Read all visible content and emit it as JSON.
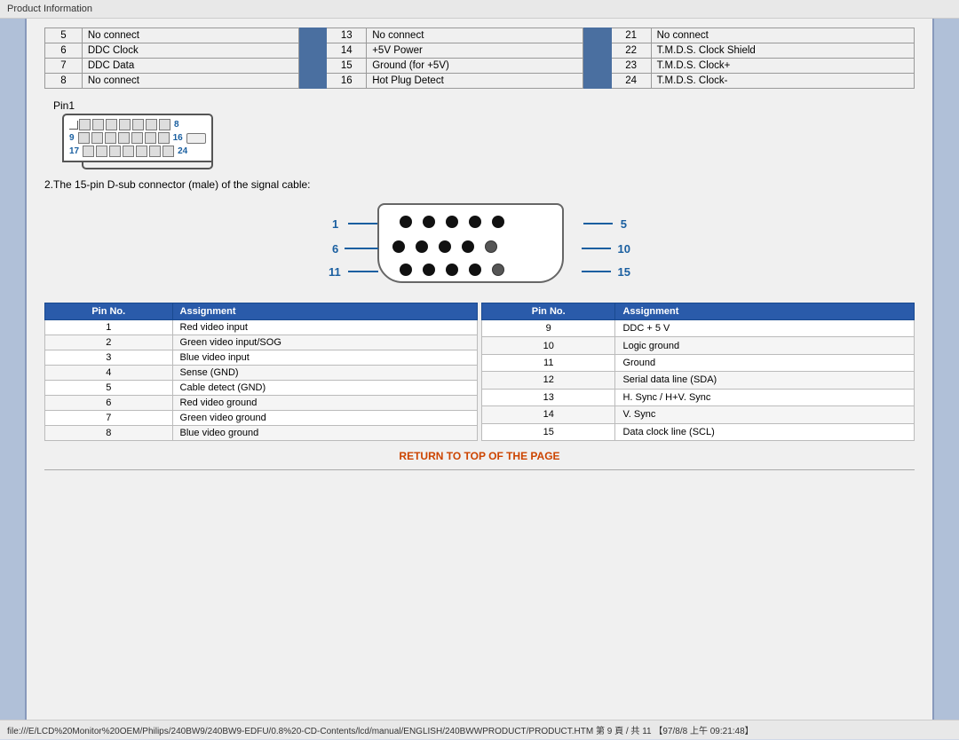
{
  "topBar": {
    "label": "Product Information"
  },
  "bottomBar": {
    "label": "file:///E/LCD%20Monitor%20OEM/Philips/240BW9/240BW9-EDFU/0.8%20-CD-Contents/lcd/manual/ENGLISH/240BWWPRODUCT/PRODUCT.HTM 第 9 頁 / 共 11 【97/8/8 上午 09:21:48】"
  },
  "upperTable": {
    "rows": [
      [
        "5",
        "No connect",
        "13",
        "No connect",
        "21",
        "No connect"
      ],
      [
        "6",
        "DDC Clock",
        "14",
        "+5V Power",
        "22",
        "T.M.D.S. Clock Shield"
      ],
      [
        "7",
        "DDC Data",
        "15",
        "Ground (for +5V)",
        "23",
        "T.M.D.S. Clock+"
      ],
      [
        "8",
        "No connect",
        "16",
        "Hot Plug Detect",
        "24",
        "T.M.D.S. Clock-"
      ]
    ]
  },
  "pin1Label": "Pin1",
  "rowLabels": [
    "8",
    "16",
    "24"
  ],
  "cornerLabels": [
    "9",
    "17"
  ],
  "dsubTitle": "2.The 15-pin D-sub connector (male) of the signal cable:",
  "dsubNumbers": {
    "left": [
      "1",
      "6",
      "11"
    ],
    "right": [
      "5",
      "10",
      "15"
    ]
  },
  "pinTableLeft": {
    "headers": [
      "Pin No.",
      "Assignment"
    ],
    "rows": [
      [
        "1",
        "Red video input"
      ],
      [
        "2",
        "Green video input/SOG"
      ],
      [
        "3",
        "Blue video input"
      ],
      [
        "4",
        "Sense (GND)"
      ],
      [
        "5",
        "Cable detect (GND)"
      ],
      [
        "6",
        "Red video ground"
      ],
      [
        "7",
        "Green video ground"
      ],
      [
        "8",
        "Blue video ground"
      ]
    ]
  },
  "pinTableRight": {
    "headers": [
      "Pin No.",
      "Assignment"
    ],
    "rows": [
      [
        "9",
        "DDC + 5 V"
      ],
      [
        "10",
        "Logic ground"
      ],
      [
        "11",
        "Ground"
      ],
      [
        "12",
        "Serial data line (SDA)"
      ],
      [
        "13",
        "H. Sync / H+V. Sync"
      ],
      [
        "14",
        "V. Sync"
      ],
      [
        "15",
        "Data clock line (SCL)"
      ]
    ]
  },
  "returnLink": "RETURN TO TOP OF THE PAGE"
}
